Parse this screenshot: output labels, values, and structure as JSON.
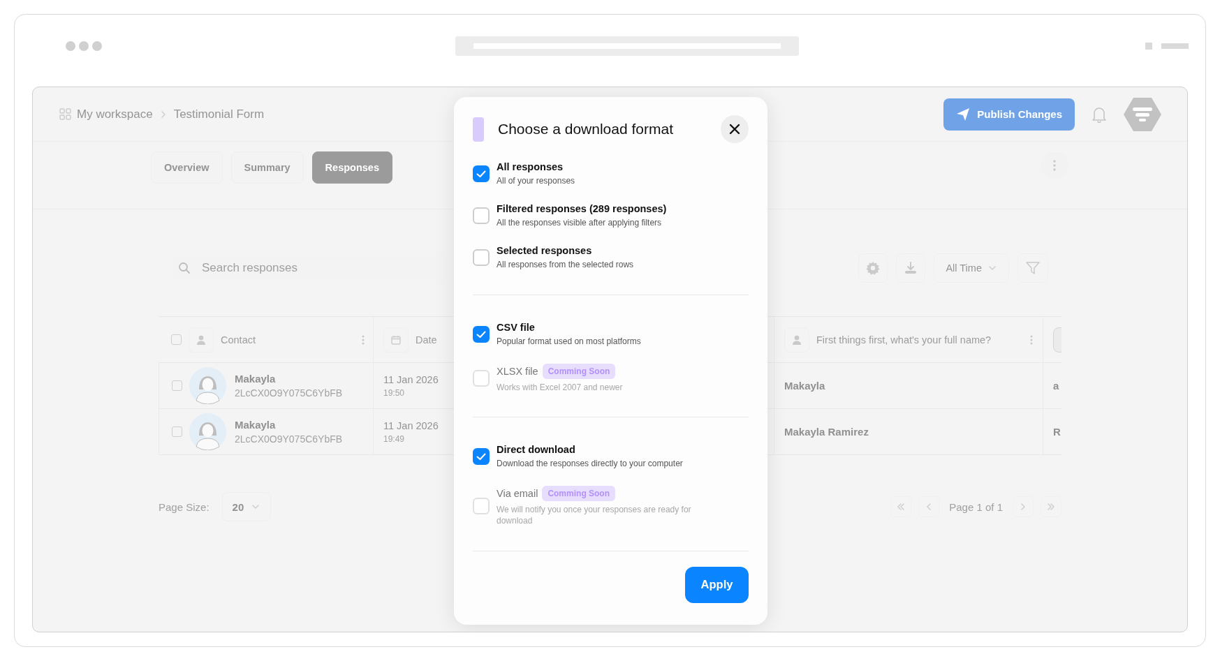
{
  "breadcrumb": [
    "My workspace",
    "Testimonial Form"
  ],
  "header": {
    "publish_button": "Publish Changes"
  },
  "tabs": [
    {
      "label": "Overview",
      "selected": false
    },
    {
      "label": "Summary",
      "selected": false
    },
    {
      "label": "Responses",
      "selected": true
    }
  ],
  "toolbar": {
    "search_placeholder": "Search responses",
    "time_filter": "All Time"
  },
  "table": {
    "select_all_checked": false,
    "columns": [
      {
        "label": "Contact"
      },
      {
        "label": "Date"
      },
      {
        "label": "First things first, what's your full name?"
      }
    ],
    "rows": [
      {
        "checked": false,
        "contact_name": "Makayla",
        "contact_id": "2LcCX0O9Y075C6YbFB",
        "date": "11 Jan 2026",
        "time": "19:50",
        "full_name": "Makayla",
        "column_4": "a"
      },
      {
        "checked": false,
        "contact_name": "Makayla",
        "contact_id": "2LcCX0O9Y075C6YbFB",
        "date": "11 Jan 2026",
        "time": "19:49",
        "full_name": "Makayla Ramirez",
        "column_4": "R"
      }
    ]
  },
  "pagination": {
    "page_size_label": "Page Size:",
    "page_size": "20",
    "page_info": "Page 1 of 1"
  },
  "dialog": {
    "title": "Choose a download format",
    "groups": [
      {
        "options": [
          {
            "label": "All responses",
            "description": "All of your responses",
            "checked": true,
            "disabled": false
          },
          {
            "label": "Filtered responses (289 responses)",
            "description": "All the responses visible after applying filters",
            "checked": false,
            "disabled": false
          },
          {
            "label": "Selected responses",
            "description": "All responses from the selected rows",
            "checked": false,
            "disabled": false
          }
        ]
      },
      {
        "options": [
          {
            "label": "CSV file",
            "description": "Popular format used on most platforms",
            "checked": true,
            "disabled": false
          },
          {
            "label": "XLSX file",
            "badge": "Comming Soon",
            "description": "Works with Excel 2007 and newer",
            "checked": false,
            "disabled": true
          }
        ]
      },
      {
        "options": [
          {
            "label": "Direct download",
            "description": "Download the responses directly to your computer",
            "checked": true,
            "disabled": false
          },
          {
            "label": "Via email",
            "badge": "Comming Soon",
            "description": "We will notify you once your responses are ready for download",
            "checked": false,
            "disabled": true
          }
        ]
      }
    ],
    "apply_button": "Apply"
  }
}
